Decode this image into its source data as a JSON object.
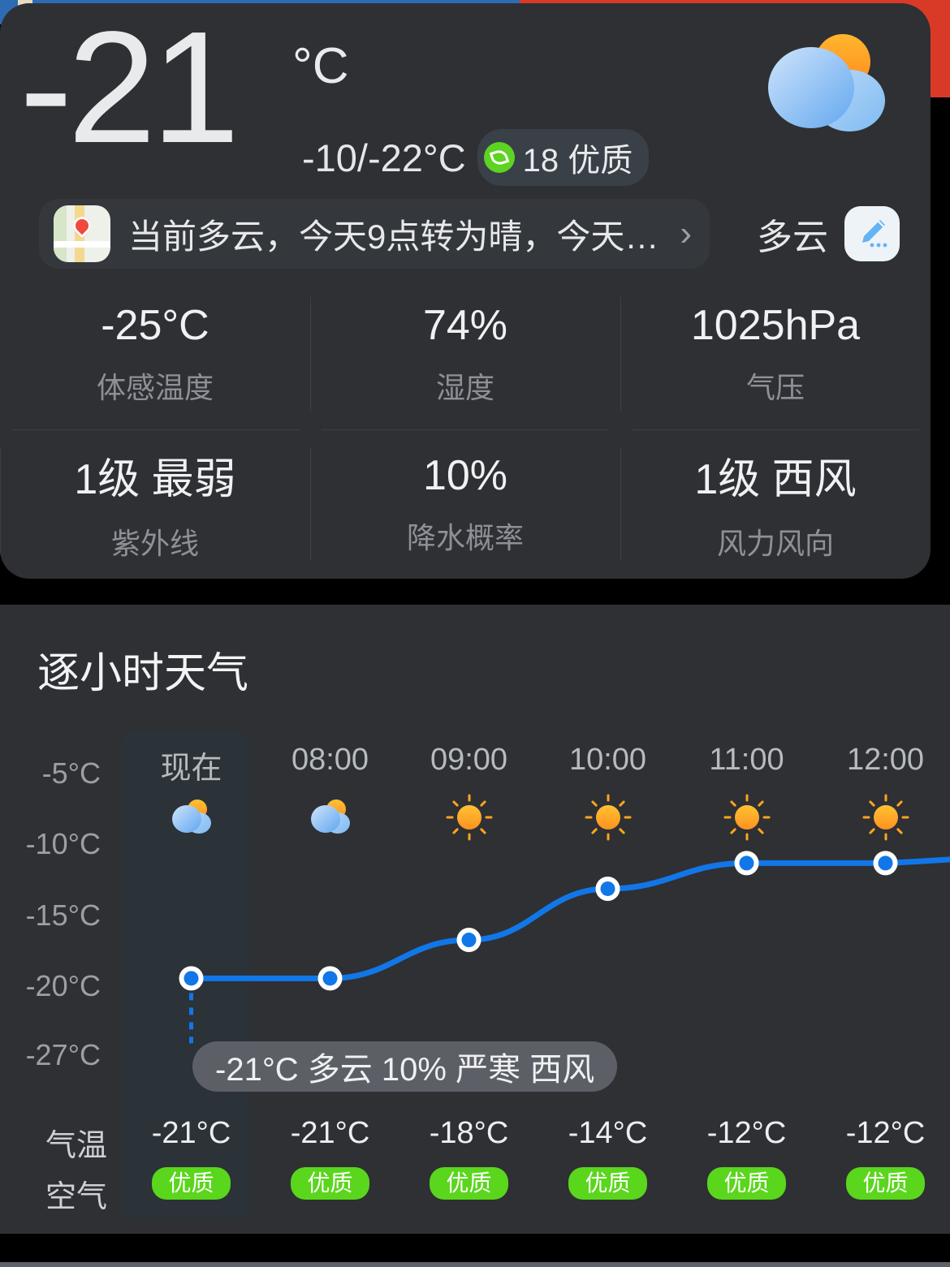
{
  "current": {
    "temperature": "-21",
    "unit": "°C",
    "range": "-10/-22°C",
    "aqi_value": "18",
    "aqi_label": "优质",
    "aqi_color": "#5dd322",
    "weather_icon": "partly-cloudy-icon",
    "location_summary": "当前多云，今天9点转为晴，今天…",
    "chevron": "›",
    "condition": "多云"
  },
  "metrics": [
    {
      "value": "-25°C",
      "label": "体感温度"
    },
    {
      "value": "74%",
      "label": "湿度"
    },
    {
      "value": "1025hPa",
      "label": "气压"
    },
    {
      "value": "1级 最弱",
      "label": "紫外线"
    },
    {
      "value": "10%",
      "label": "降水概率"
    },
    {
      "value": "1级 西风",
      "label": "风力风向"
    }
  ],
  "hourly": {
    "title": "逐小时天气",
    "row_label_temp": "气温",
    "row_label_air": "空气",
    "tooltip": "-21°C 多云 10% 严寒 西风",
    "line_color": "#1177e8"
  },
  "chart_data": {
    "type": "line",
    "title": "逐小时天气",
    "xlabel": "",
    "ylabel": "气温",
    "categories": [
      "现在",
      "08:00",
      "09:00",
      "10:00",
      "11:00",
      "12:00"
    ],
    "values": [
      -21,
      -21,
      -18,
      -14,
      -12,
      -12
    ],
    "value_labels": [
      "-21°C",
      "-21°C",
      "-18°C",
      "-14°C",
      "-12°C",
      "-12°C"
    ],
    "icons": [
      "partly-cloudy-icon",
      "partly-cloudy-icon",
      "sunny-icon",
      "sunny-icon",
      "sunny-icon",
      "sunny-icon"
    ],
    "air_quality": [
      "优质",
      "优质",
      "优质",
      "优质",
      "优质",
      "优质"
    ],
    "yticks": [
      -5,
      -10,
      -15,
      -20,
      -27
    ],
    "ytick_labels": [
      "-5°C",
      "-10°C",
      "-15°C",
      "-20°C",
      "-27°C"
    ],
    "ylim": [
      -27,
      -5
    ],
    "grid": false,
    "legend": "none",
    "highlighted_index": 0
  }
}
